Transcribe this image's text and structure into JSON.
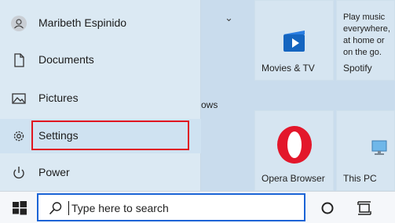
{
  "start_menu": {
    "user_name": "Maribeth Espinido",
    "items": [
      {
        "label": "Documents",
        "icon": "document-icon"
      },
      {
        "label": "Pictures",
        "icon": "pictures-icon"
      },
      {
        "label": "Settings",
        "icon": "gear-icon"
      },
      {
        "label": "Power",
        "icon": "power-icon"
      }
    ]
  },
  "tiles": {
    "partial_label": "ows",
    "movies_tv": "Movies & TV",
    "spotify_promo": "Play music everywhere, at home or on the go.",
    "spotify": "Spotify",
    "opera": "Opera Browser",
    "this_pc": "This PC"
  },
  "taskbar": {
    "search_placeholder": "Type here to search"
  },
  "colors": {
    "highlight_outline": "#e0151f",
    "search_border": "#1b64d6",
    "opera_red": "#e3172b",
    "movies_blue": "#1565c0"
  }
}
